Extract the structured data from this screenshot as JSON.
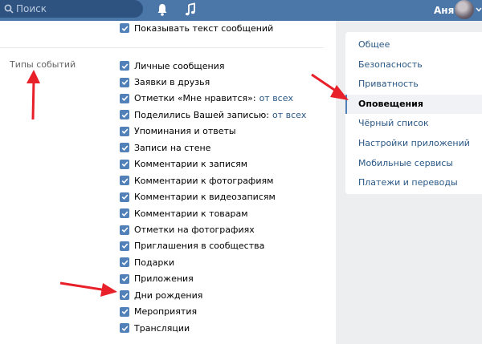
{
  "header": {
    "search_placeholder": "Поиск",
    "user_name": "Аня",
    "icons": [
      "search-icon",
      "bell-icon",
      "music-icon",
      "chevron-down-icon"
    ],
    "brand_color": "#4a76a8"
  },
  "main": {
    "top_option": "Показывать текст сообщений",
    "section_label": "Типы событий",
    "options": [
      {
        "label": "Личные сообщения"
      },
      {
        "label": "Заявки в друзья"
      },
      {
        "label": "Отметки «Мне нравится»:",
        "link": "от всех"
      },
      {
        "label": "Поделились Вашей записью:",
        "link": "от всех"
      },
      {
        "label": "Упоминания и ответы"
      },
      {
        "label": "Записи на стене"
      },
      {
        "label": "Комментарии к записям"
      },
      {
        "label": "Комментарии к фотографиям"
      },
      {
        "label": "Комментарии к видеозаписям"
      },
      {
        "label": "Комментарии к товарам"
      },
      {
        "label": "Отметки на фотографиях"
      },
      {
        "label": "Приглашения в сообщества"
      },
      {
        "label": "Подарки"
      },
      {
        "label": "Приложения"
      },
      {
        "label": "Дни рождения"
      },
      {
        "label": "Мероприятия"
      },
      {
        "label": "Трансляции"
      }
    ],
    "checkbox_color": "#5181b8",
    "link_color": "#2a5885"
  },
  "menu": {
    "items": [
      {
        "label": "Общее"
      },
      {
        "label": "Безопасность"
      },
      {
        "label": "Приватность"
      },
      {
        "label": "Оповещения",
        "active": true
      },
      {
        "label": "Чёрный список"
      },
      {
        "label": "Настройки приложений"
      },
      {
        "label": "Мобильные сервисы"
      },
      {
        "label": "Платежи и переводы"
      }
    ]
  },
  "annotation_color": "#e8202a"
}
